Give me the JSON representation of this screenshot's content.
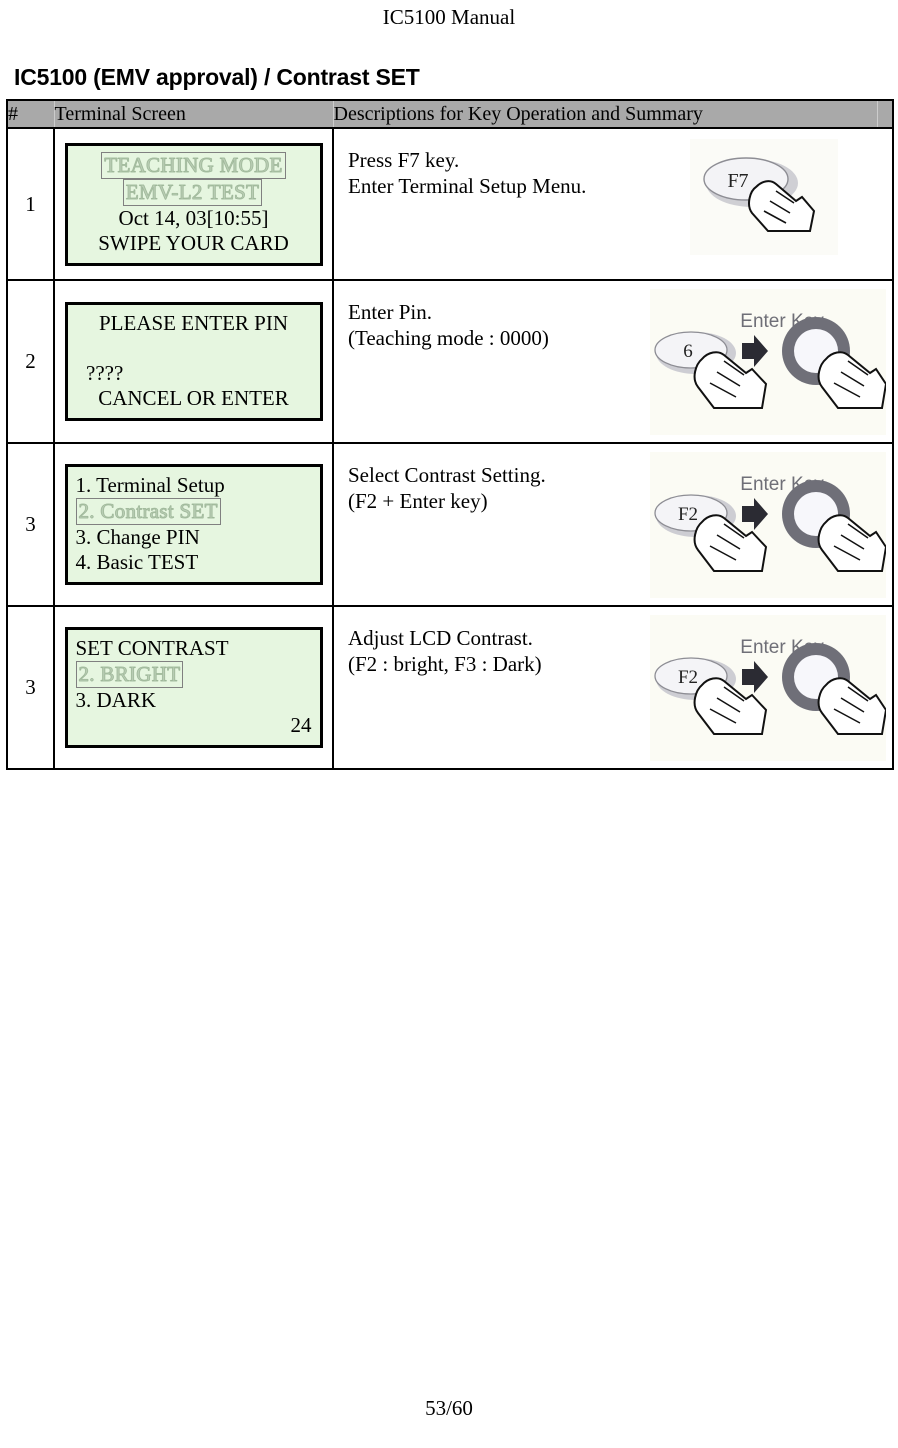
{
  "page": {
    "header": "IC5100 Manual",
    "footer": "53/60",
    "section_title": "IC5100 (EMV approval) / Contrast SET"
  },
  "table": {
    "columns": [
      "#",
      "Terminal Screen",
      "Descriptions for Key Operation and Summary",
      ""
    ],
    "rows": [
      {
        "num": "1",
        "screen_lines": [
          {
            "text": "TEACHING MODE",
            "style": "hollow",
            "align": "center"
          },
          {
            "text": "EMV-L2 TEST",
            "style": "hollow",
            "align": "center"
          },
          {
            "text": "Oct 14, 03[10:55]",
            "style": "plain",
            "align": "center"
          },
          {
            "text": "SWIPE YOUR CARD",
            "style": "plain",
            "align": "center"
          }
        ],
        "description": "Press F7 key.\nEnter Terminal Setup Menu.",
        "art": {
          "type": "single-key",
          "key_label": "F7",
          "enter_label": ""
        }
      },
      {
        "num": "2",
        "screen_lines": [
          {
            "text": "PLEASE ENTER PIN",
            "style": "plain",
            "align": "center"
          },
          {
            "text": "",
            "style": "blank",
            "align": "center"
          },
          {
            "text": "  ????",
            "style": "plain",
            "align": "left"
          },
          {
            "text": "CANCEL OR ENTER",
            "style": "plain",
            "align": "center"
          }
        ],
        "description": "Enter Pin.\n(Teaching mode : 0000)",
        "art": {
          "type": "key-plus-enter",
          "key_label": "6",
          "enter_label": "Enter Key"
        }
      },
      {
        "num": "3",
        "screen_lines": [
          {
            "text": "1. Terminal Setup",
            "style": "plain",
            "align": "left"
          },
          {
            "text": "2. Contrast SET",
            "style": "hollow",
            "align": "left"
          },
          {
            "text": "3. Change PIN",
            "style": "plain",
            "align": "left"
          },
          {
            "text": "4. Basic TEST",
            "style": "plain",
            "align": "left"
          }
        ],
        "description": "Select Contrast Setting.\n(F2 + Enter key)",
        "art": {
          "type": "key-plus-enter",
          "key_label": "F2",
          "enter_label": "Enter Key"
        }
      },
      {
        "num": "3",
        "screen_lines": [
          {
            "text": "SET CONTRAST",
            "style": "plain",
            "align": "left"
          },
          {
            "text": "2. BRIGHT",
            "style": "hollow",
            "align": "left"
          },
          {
            "text": "3. DARK",
            "style": "plain",
            "align": "left"
          },
          {
            "text": "24",
            "style": "plain",
            "align": "right"
          }
        ],
        "description": "Adjust LCD Contrast.\n(F2 : bright, F3 : Dark)",
        "art": {
          "type": "key-plus-enter",
          "key_label": "F2",
          "enter_label": "Enter Key"
        }
      }
    ]
  },
  "colors": {
    "lcd_background": "#e6f6e0",
    "header_background": "#a9a9a9",
    "border": "#000000"
  }
}
